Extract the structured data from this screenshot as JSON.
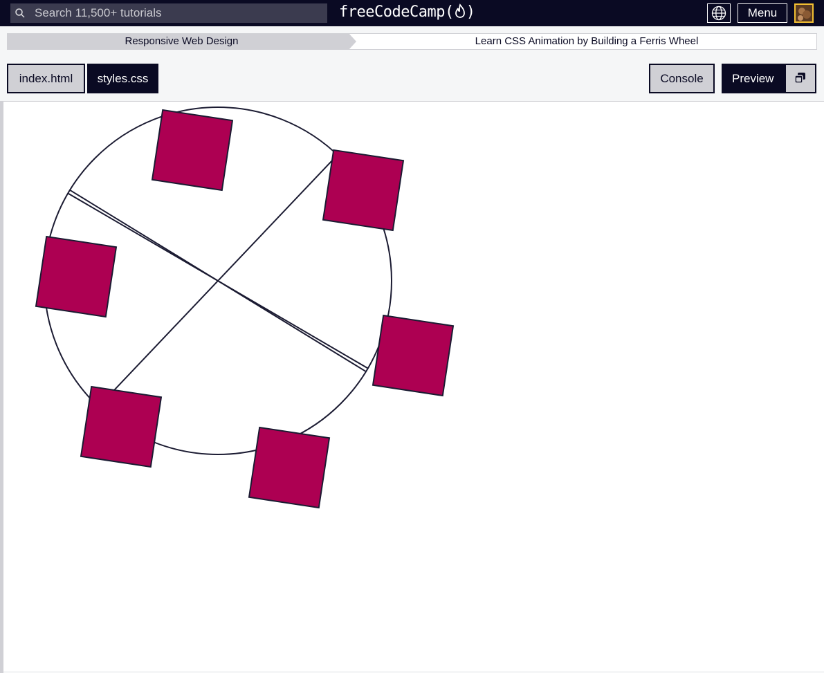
{
  "topnav": {
    "search_placeholder": "Search 11,500+ tutorials",
    "brand": "freeCodeCamp",
    "brand_open": "(",
    "brand_close": ")",
    "menu_label": "Menu",
    "icons": [
      "search-icon",
      "flame-icon",
      "globe-icon",
      "avatar"
    ]
  },
  "breadcrumb": {
    "superblock": "Responsive Web Design",
    "block": "Learn CSS Animation by Building a Ferris Wheel"
  },
  "tabs": {
    "index": "index.html",
    "styles": "styles.css",
    "console": "Console",
    "preview": "Preview",
    "active": "styles.css"
  },
  "preview": {
    "wheel": {
      "spoke_count": 3,
      "cabin_count": 6,
      "rotation_deg": 15,
      "cabin_color": "#ad0052",
      "line_color": "#1b1b32"
    }
  },
  "colors": {
    "nav_bg": "#0a0a23",
    "search_bg": "#3b3b4f",
    "tab_inactive": "#d0d0d5",
    "avatar_border": "#f1be32"
  }
}
